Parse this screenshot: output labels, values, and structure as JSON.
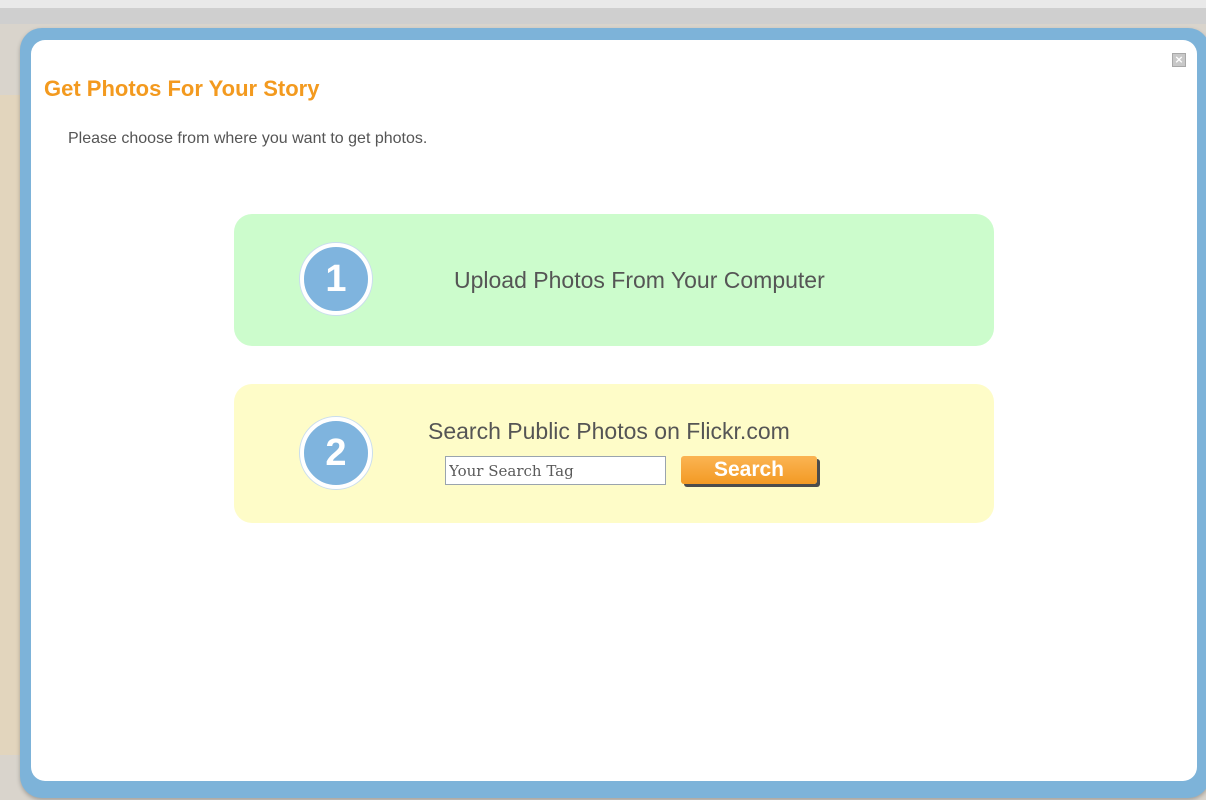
{
  "dialog": {
    "title": "Get Photos For Your Story",
    "subtitle": "Please choose from where you want to get photos.",
    "close_icon": "close-icon"
  },
  "options": [
    {
      "number": "1",
      "label": "Upload Photos From Your Computer"
    },
    {
      "number": "2",
      "label": "Search Public Photos on Flickr.com",
      "search": {
        "value": "",
        "placeholder": "Your Search Tag",
        "button_label": "Search"
      }
    }
  ],
  "colors": {
    "accent_orange": "#f39a1f",
    "frame_blue": "#7db3d9",
    "upload_card": "#ccfccc",
    "flickr_card": "#fefcc8",
    "step_circle": "#7fb4de",
    "search_button": "#f39a24"
  }
}
